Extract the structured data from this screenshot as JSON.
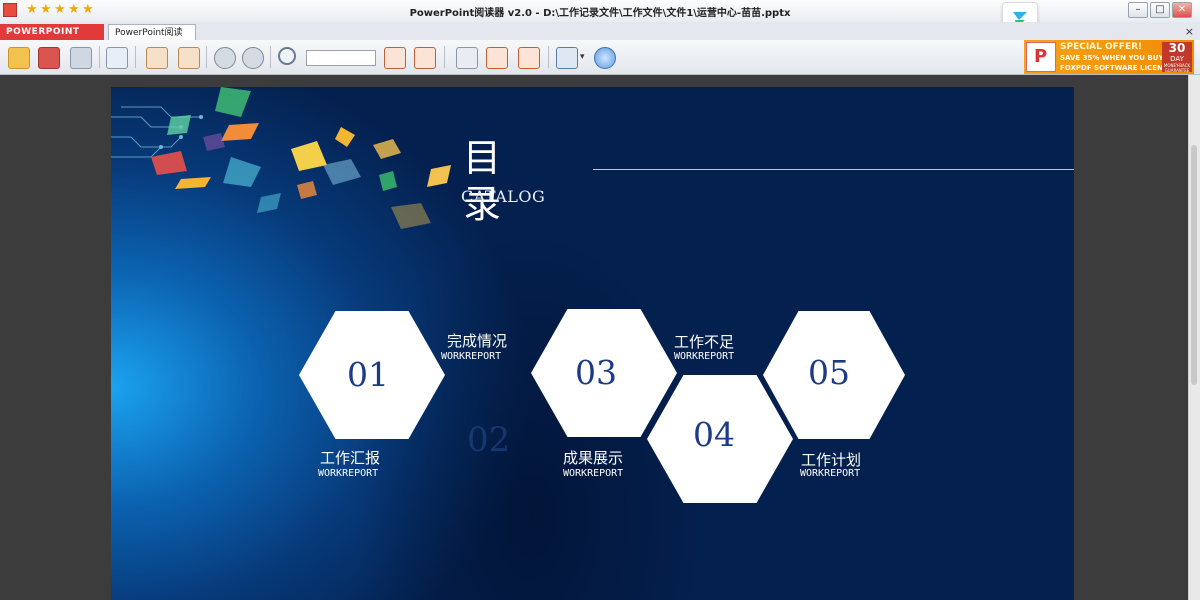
{
  "window": {
    "title": "PowerPoint阅读器 v2.0 - D:\\工作记录文件\\工作文件\\文件1\\运营中心-苗苗.pptx",
    "rating_stars": 5
  },
  "tabs": {
    "logo_label": "POWERPOINT",
    "active_label": "PowerPoint阅读器",
    "close_glyph": "×"
  },
  "window_controls": {
    "minimize": "–",
    "maximize": "□",
    "close": "✕"
  },
  "ad": {
    "line1": "SPECIAL OFFER!",
    "line2": "SAVE 35% WHEN YOU BUY",
    "line3": "FOXPDF SOFTWARE LICENSES.",
    "days_number": "30",
    "days_unit": "DAY",
    "days_small": "MONEY-BACK GUARANTEE"
  },
  "slide": {
    "title": "目录",
    "subtitle": "CATALOG",
    "items": [
      {
        "number": "01",
        "label": "工作汇报",
        "sublabel": "WORKREPORT"
      },
      {
        "number": "02",
        "label": "完成情况",
        "sublabel": "WORKREPORT"
      },
      {
        "number": "03",
        "label": "成果展示",
        "sublabel": "WORKREPORT"
      },
      {
        "number": "04",
        "label": "工作不足",
        "sublabel": "WORKREPORT"
      },
      {
        "number": "05",
        "label": "工作计划",
        "sublabel": "WORKREPORT"
      }
    ],
    "colors": {
      "hex_fill": "#ffffff",
      "number_color": "#1c3a86",
      "bg_light": "#1ba3f0",
      "bg_dark": "#04204e"
    }
  }
}
